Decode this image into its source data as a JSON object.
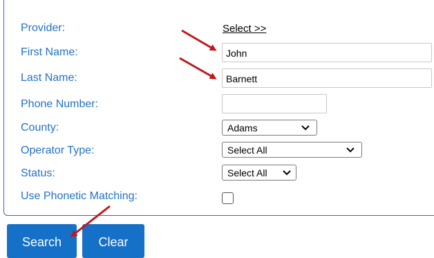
{
  "form": {
    "provider_label": "Provider:",
    "provider_link": "Select  >>",
    "first_name_label": "First Name:",
    "first_name_value": "John",
    "last_name_label": "Last Name:",
    "last_name_value": "Barnett",
    "phone_label": "Phone Number:",
    "phone_value": "",
    "county_label": "County:",
    "county_value": "Adams",
    "operator_type_label": "Operator Type:",
    "operator_type_value": "Select All",
    "status_label": "Status:",
    "status_value": "Select All",
    "phonetic_label": "Use Phonetic Matching:",
    "phonetic_checked": false
  },
  "buttons": {
    "search_label": "Search",
    "clear_label": "Clear"
  },
  "colors": {
    "label": "#2372c4",
    "button": "#1570c8",
    "annotation_arrow": "#c0171c"
  }
}
